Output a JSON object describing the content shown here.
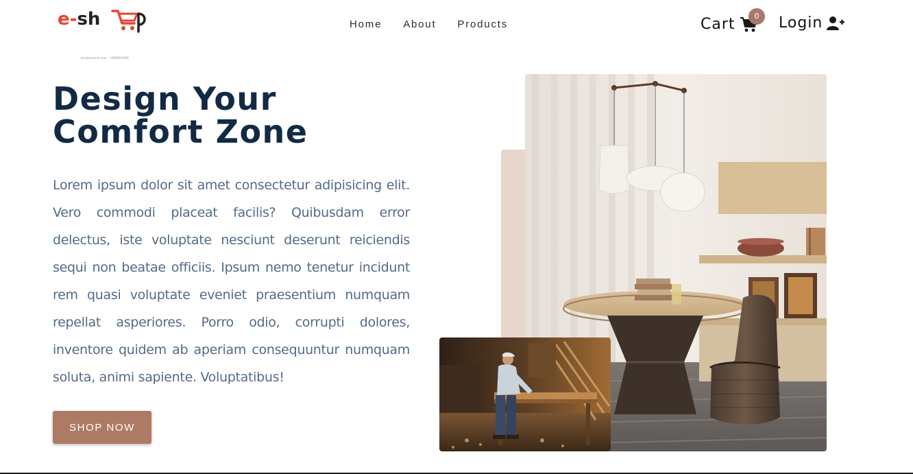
{
  "header": {
    "logo": {
      "text_e": "e-",
      "text_rest": "sh",
      "icon": "cart-logo-icon"
    },
    "nav": [
      {
        "label": "Home"
      },
      {
        "label": "About"
      },
      {
        "label": "Products"
      }
    ],
    "cart": {
      "label": "Cart",
      "count": "0",
      "icon": "shopping-cart-icon"
    },
    "login": {
      "label": "Login",
      "icon": "user-plus-icon"
    }
  },
  "watermark": "shutterstock.com · 1968053609",
  "hero": {
    "title_line1": "Design Your",
    "title_line2": "Comfort Zone",
    "text": "Lorem ipsum dolor sit amet consectetur adipisicing elit. Vero commodi placeat facilis? Quibusdam error delectus, iste voluptate nesciunt deserunt reiciendis sequi non beatae officiis. Ipsum nemo tenetur incidunt rem quasi voluptate eveniet praesentium numquam repellat asperiores. Porro odio, corrupti dolores, inventore quidem ab aperiam consequuntur numquam soluta, animi sapiente. Voluptatibus!",
    "button_label": "SHOP NOW"
  },
  "images": {
    "main": "dining-room-photo",
    "secondary": "carpenter-workshop-photo"
  },
  "colors": {
    "accent": "#ad7a63",
    "title": "#132a45",
    "text": "#526a86",
    "badge": "#a8786a",
    "logo_red": "#e8452e",
    "accent_block": "#e8d6cd"
  }
}
